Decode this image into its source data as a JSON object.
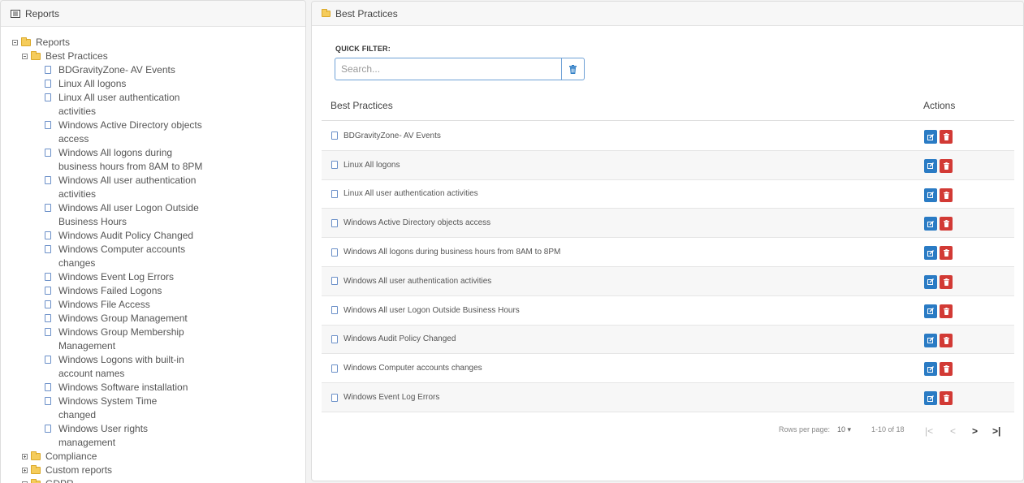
{
  "left_panel": {
    "title": "Reports",
    "tree": {
      "root": "Reports",
      "expanded_folder": "Best Practices",
      "items": [
        {
          "lines": [
            "BDGravityZone- AV Events"
          ]
        },
        {
          "lines": [
            "Linux All logons"
          ]
        },
        {
          "lines": [
            "Linux All user authentication",
            "activities"
          ]
        },
        {
          "lines": [
            "Windows Active Directory objects",
            "access"
          ]
        },
        {
          "lines": [
            "Windows All logons during",
            "business hours from 8AM to 8PM"
          ]
        },
        {
          "lines": [
            "Windows All user authentication",
            "activities"
          ]
        },
        {
          "lines": [
            "Windows All user Logon Outside",
            "Business Hours"
          ]
        },
        {
          "lines": [
            "Windows Audit Policy Changed"
          ]
        },
        {
          "lines": [
            "Windows Computer accounts",
            "changes"
          ]
        },
        {
          "lines": [
            "Windows Event Log Errors"
          ]
        },
        {
          "lines": [
            "Windows Failed Logons"
          ]
        },
        {
          "lines": [
            "Windows File Access"
          ]
        },
        {
          "lines": [
            "Windows Group Management"
          ]
        },
        {
          "lines": [
            "Windows Group Membership",
            "Management"
          ]
        },
        {
          "lines": [
            "Windows Logons with built-in",
            "account names"
          ]
        },
        {
          "lines": [
            "Windows Software installation"
          ]
        },
        {
          "lines": [
            "Windows System Time",
            "changed"
          ]
        },
        {
          "lines": [
            "Windows User rights",
            "management"
          ]
        }
      ],
      "collapsed_folders": [
        "Compliance",
        "Custom reports",
        "GDPR"
      ]
    }
  },
  "right_panel": {
    "title": "Best Practices",
    "quick_filter_label": "QUICK FILTER:",
    "search_placeholder": "Search...",
    "search_value": "",
    "table": {
      "col_name": "Best Practices",
      "col_actions": "Actions",
      "rows": [
        "BDGravityZone- AV Events",
        "Linux All logons",
        "Linux All user authentication activities",
        "Windows Active Directory objects access",
        "Windows All logons during business hours from 8AM to 8PM",
        "Windows All user authentication activities",
        "Windows All user Logon Outside Business Hours",
        "Windows Audit Policy Changed",
        "Windows Computer accounts changes",
        "Windows Event Log Errors"
      ]
    },
    "pager": {
      "rows_per_page_label": "Rows per page:",
      "rows_per_page_value": "10",
      "range": "1-10 of 18",
      "first": "|<",
      "prev": "<",
      "next": ">",
      "last": ">|"
    }
  },
  "colors": {
    "edit_button": "#2a7bc4",
    "delete_button": "#d23a35",
    "folder": "#f5cc5b",
    "search_border": "#6fa1d6"
  }
}
